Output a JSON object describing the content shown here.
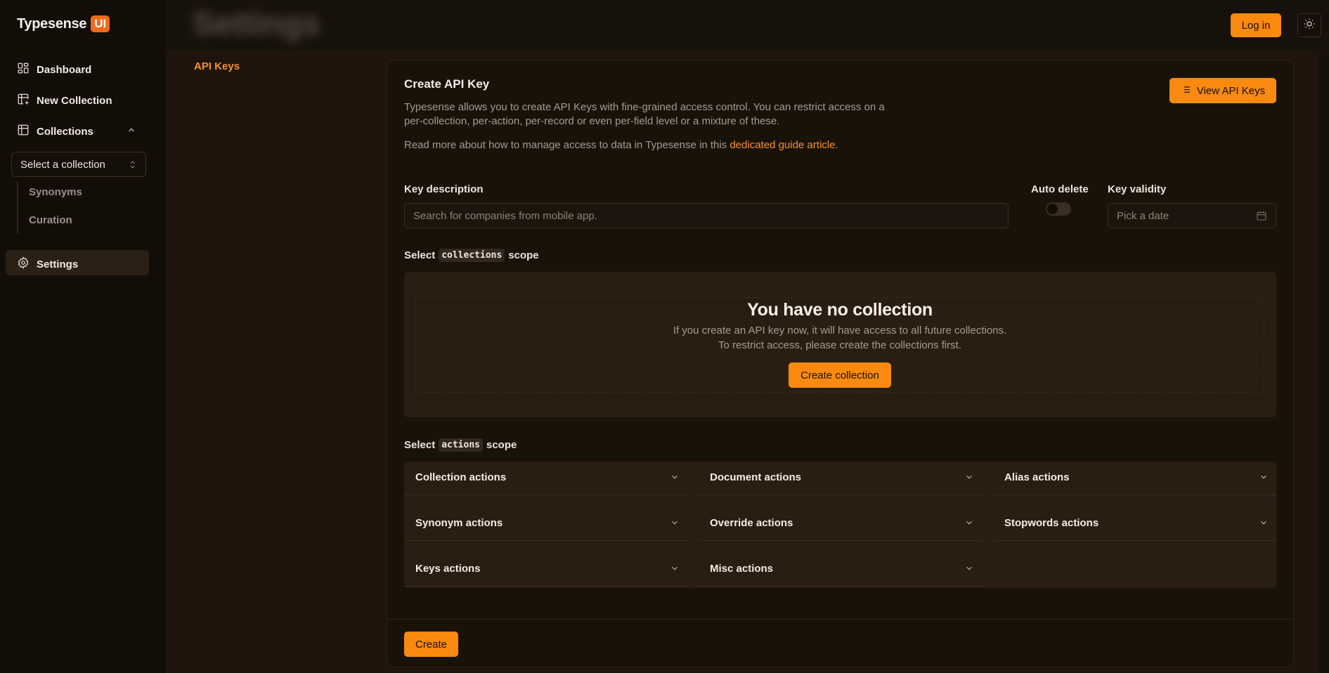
{
  "brand": {
    "name": "Typesense",
    "badge": "UI"
  },
  "sidebar": {
    "items": [
      {
        "label": "Dashboard",
        "icon": "dashboard-icon"
      },
      {
        "label": "New Collection",
        "icon": "table-plus-icon"
      },
      {
        "label": "Collections",
        "icon": "table-icon"
      },
      {
        "label": "Settings",
        "icon": "gear-icon"
      }
    ],
    "select_collection": "Select a collection",
    "subitems": [
      "Synonyms",
      "Curation"
    ]
  },
  "header": {
    "login": "Log in",
    "theme_icon": "sun-icon",
    "title": "Settings"
  },
  "settings_nav": {
    "api_keys": "API Keys"
  },
  "card": {
    "title": "Create API Key",
    "view_keys": "View API Keys",
    "description": "Typesense allows you to create API Keys with fine-grained access control. You can restrict access on a per-collection, per-action, per-record or even per-field level or a mixture of these.",
    "readmore_prefix": "Read more about how to manage access to data in Typesense in this ",
    "readmore_link": "dedicated guide article",
    "readmore_suffix": ".",
    "key_description_label": "Key description",
    "key_description_placeholder": "Search for companies from mobile app.",
    "auto_delete_label": "Auto delete",
    "key_validity_label": "Key validity",
    "key_validity_placeholder": "Pick a date",
    "collections_scope": {
      "prefix": "Select",
      "code": "collections",
      "suffix": "scope"
    },
    "empty": {
      "title": "You have no collection",
      "line1": "If you create an API key now, it will have access to all future collections.",
      "line2": "To restrict access, please create the collections first.",
      "button": "Create collection"
    },
    "actions_scope": {
      "prefix": "Select",
      "code": "actions",
      "suffix": "scope"
    },
    "actions": [
      "Collection actions",
      "Document actions",
      "Alias actions",
      "Synonym actions",
      "Override actions",
      "Stopwords actions",
      "Keys actions",
      "Misc actions"
    ],
    "create": "Create"
  },
  "colors": {
    "accent": "#f98a0f",
    "link": "#f5922e",
    "background": "#16100b"
  }
}
